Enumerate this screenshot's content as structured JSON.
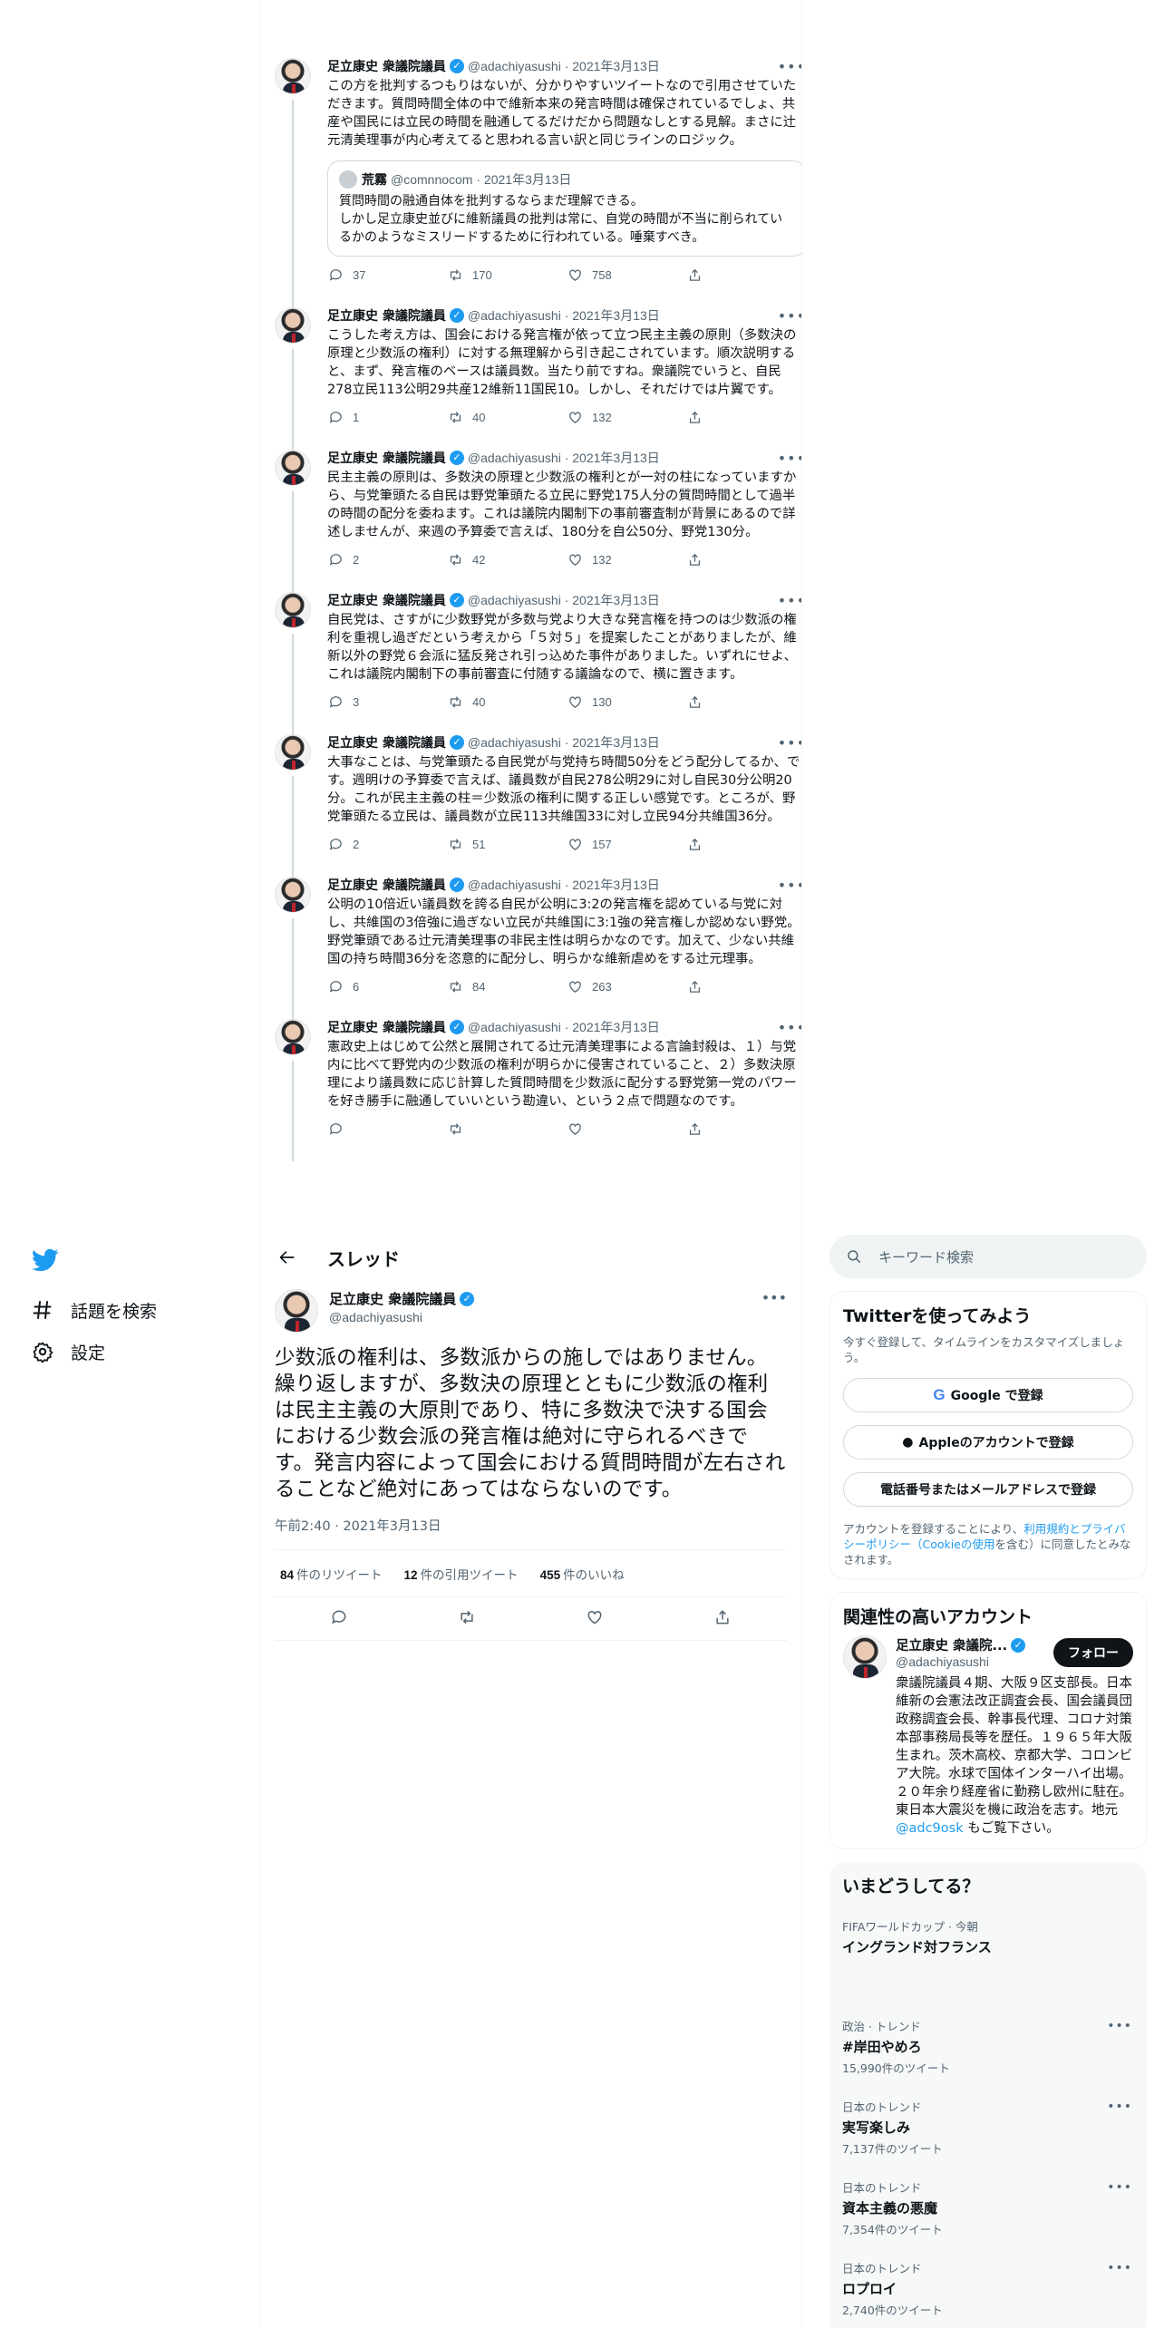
{
  "thread_tweets": [
    {
      "name": "足立康史 衆議院議員",
      "handle": "@adachiyasushi",
      "date": "2021年3月13日",
      "text": "この方を批判するつもりはないが、分かりやすいツイートなので引用させていただきます。質問時間全体の中で維新本来の発言時間は確保されているでしょ、共産や国民には立民の時間を融通してるだけだから問題なしとする見解。まさに辻元清美理事が内心考えてると思われる言い訳と同じラインのロジック。",
      "quote": {
        "name": "荒霧",
        "handle": "@comnnocom",
        "date": "2021年3月13日",
        "text": "質問時間の融通自体を批判するならまだ理解できる。\nしかし足立康史並びに維新議員の批判は常に、自党の時間が不当に削られているかのようなミスリードするために行われている。唾棄すべき。"
      },
      "replies": "37",
      "retweets": "170",
      "likes": "758"
    },
    {
      "name": "足立康史 衆議院議員",
      "handle": "@adachiyasushi",
      "date": "2021年3月13日",
      "text": "こうした考え方は、国会における発言権が依って立つ民主主義の原則（多数決の原理と少数派の権利）に対する無理解から引き起こされています。順次説明すると、まず、発言権のベースは議員数。当たり前ですね。衆議院でいうと、自民278立民113公明29共産12維新11国民10。しかし、それだけでは片翼です。",
      "replies": "1",
      "retweets": "40",
      "likes": "132"
    },
    {
      "name": "足立康史 衆議院議員",
      "handle": "@adachiyasushi",
      "date": "2021年3月13日",
      "text": "民主主義の原則は、多数決の原理と少数派の権利とが一対の柱になっていますから、与党筆頭たる自民は野党筆頭たる立民に野党175人分の質問時間として過半の時間の配分を委ねます。これは議院内閣制下の事前審査制が背景にあるので詳述しませんが、来週の予算委で言えば、180分を自公50分、野党130分。",
      "replies": "2",
      "retweets": "42",
      "likes": "132"
    },
    {
      "name": "足立康史 衆議院議員",
      "handle": "@adachiyasushi",
      "date": "2021年3月13日",
      "text": "自民党は、さすがに少数野党が多数与党より大きな発言権を持つのは少数派の権利を重視し過ぎだという考えから「５対５」を提案したことがありましたが、維新以外の野党６会派に猛反発され引っ込めた事件がありました。いずれにせよ、これは議院内閣制下の事前審査に付随する議論なので、横に置きます。",
      "replies": "3",
      "retweets": "40",
      "likes": "130"
    },
    {
      "name": "足立康史 衆議院議員",
      "handle": "@adachiyasushi",
      "date": "2021年3月13日",
      "text": "大事なことは、与党筆頭たる自民党が与党持ち時間50分をどう配分してるか、です。週明けの予算委で言えば、議員数が自民278公明29に対し自民30分公明20分。これが民主主義の柱＝少数派の権利に関する正しい感覚です。ところが、野党筆頭たる立民は、議員数が立民113共維国33に対し立民94分共維国36分。",
      "replies": "2",
      "retweets": "51",
      "likes": "157"
    },
    {
      "name": "足立康史 衆議院議員",
      "handle": "@adachiyasushi",
      "date": "2021年3月13日",
      "text": "公明の10倍近い議員数を誇る自民が公明に3:2の発言権を認めている与党に対し、共維国の3倍強に過ぎない立民が共維国に3:1強の発言権しか認めない野党。野党筆頭である辻元清美理事の非民主性は明らかなのです。加えて、少ない共維国の持ち時間36分を恣意的に配分し、明らかな維新虐めをする辻元理事。",
      "replies": "6",
      "retweets": "84",
      "likes": "263"
    },
    {
      "name": "足立康史 衆議院議員",
      "handle": "@adachiyasushi",
      "date": "2021年3月13日",
      "text": "憲政史上はじめて公然と展開されてる辻元清美理事による言論封殺は、１）与党内に比べて野党内の少数派の権利が明らかに侵害されていること、２）多数決原理により議員数に応じ計算した質問時間を少数派に配分する野党第一党のパワーを好き勝手に融通していいという勘違い、という２点で問題なのです。",
      "replies": "",
      "retweets": "",
      "likes": ""
    }
  ],
  "nav": {
    "logo": "twitter-bird-icon",
    "items": [
      {
        "label": "話題を検索",
        "icon": "hashtag-icon"
      },
      {
        "label": "設定",
        "icon": "gear-icon"
      }
    ]
  },
  "main": {
    "header_title": "スレッド",
    "focus": {
      "name": "足立康史 衆議院議員",
      "handle": "@adachiyasushi",
      "text": "少数派の権利は、多数派からの施しではありません。繰り返しますが、多数決の原理とともに少数派の権利は民主主義の大原則であり、特に多数決で決する国会における少数会派の発言権は絶対に守られるべきです。発言内容によって国会における質問時間が左右されることなど絶対にあってはならないのです。",
      "timestamp": "午前2:40 · 2021年3月13日",
      "retweets": "84",
      "retweets_label": "件のリツイート",
      "quotes": "12",
      "quotes_label": "件の引用ツイート",
      "likes": "455",
      "likes_label": "件のいいね"
    }
  },
  "sidebar": {
    "search_placeholder": "キーワード検索",
    "signup": {
      "title": "Twitterを使ってみよう",
      "subtitle": "今すぐ登録して、タイムラインをカスタマイズしましょう。",
      "google_label": "Google で登録",
      "apple_label": "Appleのアカウントで登録",
      "phone_label": "電話番号またはメールアドレスで登録",
      "legal_prefix": "アカウントを登録することにより、",
      "legal_link": "利用規約とプライバシーポリシー（Cookieの使用",
      "legal_suffix": "を含む）に同意したとみなされます。"
    },
    "related": {
      "title": "関連性の高いアカウント",
      "name": "足立康史 衆議院...",
      "handle": "@adachiyasushi",
      "follow_label": "フォロー",
      "bio": "衆議院議員４期、大阪９区支部長。日本維新の会憲法改正調査会長、国会議員団政務調査会長、幹事長代理、コロナ対策本部事務局長等を歴任。１９６５年大阪生まれ。茨木高校、京都大学、コロンビア大院。水球で国体インターハイ出場。２０年余り経産省に勤務し欧州に駐在。東日本大震災を機に政治を志す。地元",
      "bio_link": "@adc9osk",
      "bio_suffix": "もご覧下さい。"
    },
    "trends": {
      "title": "いまどうしてる？",
      "items": [
        {
          "context": "FIFAワールドカップ · 今朝",
          "name": "イングランド対フランス",
          "count": ""
        },
        {
          "context": "政治 · トレンド",
          "name": "#岸田やめろ",
          "count": "15,990件のツイート"
        },
        {
          "context": "日本のトレンド",
          "name": "実写楽しみ",
          "count": "7,137件のツイート"
        },
        {
          "context": "日本のトレンド",
          "name": "資本主義の悪魔",
          "count": "7,354件のツイート"
        },
        {
          "context": "日本のトレンド",
          "name": "ロプロイ",
          "count": "2,740件のツイート"
        }
      ]
    }
  },
  "colors": {
    "accent": "#1d9bf0",
    "text": "#0f1419",
    "muted": "#536471",
    "border": "#eff3f4"
  }
}
